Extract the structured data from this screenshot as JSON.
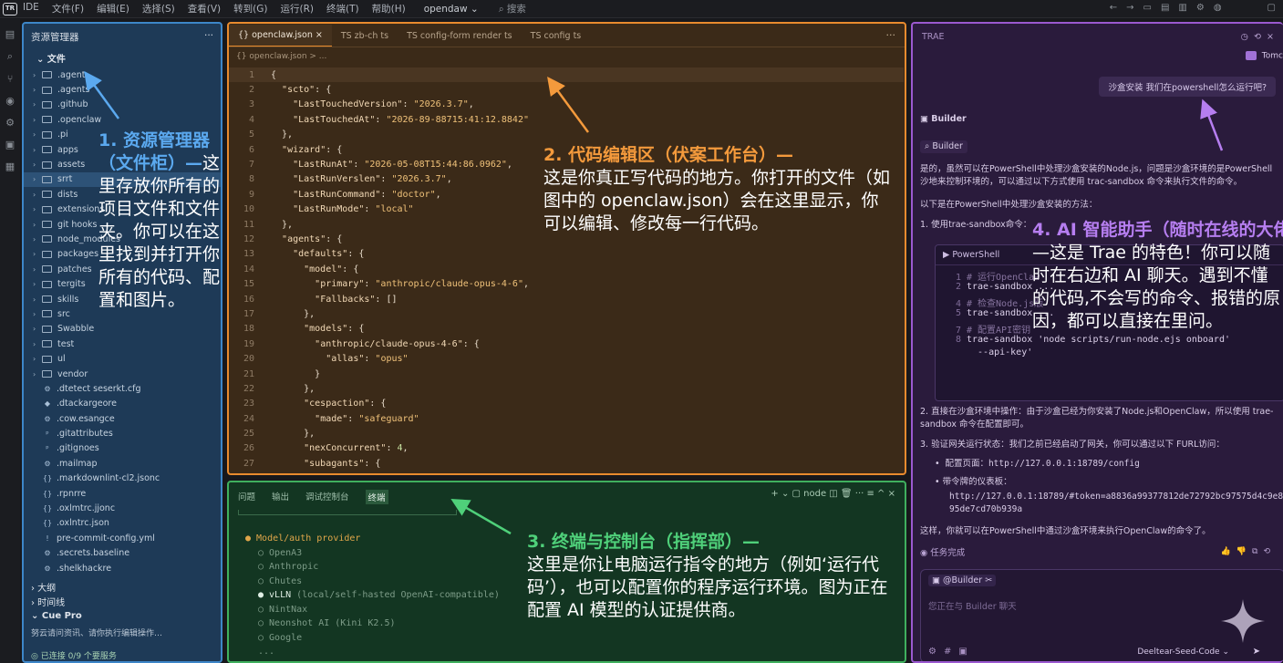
{
  "menubar": {
    "logo": "TR",
    "items": [
      "IDE",
      "文件(F)",
      "编辑(E)",
      "选择(S)",
      "查看(V)",
      "转到(G)",
      "运行(R)",
      "终端(T)",
      "帮助(H)"
    ],
    "project": "opendaw ⌄",
    "search": "⌕ 搜索"
  },
  "explorer": {
    "title": "资源管理器",
    "menu": "···",
    "section": "⌄ 文件",
    "folders": [
      ".agent",
      ".agents",
      ".github",
      ".openclaw",
      ".pi",
      "apps",
      "assets",
      "srrt",
      "dists",
      "extensions",
      "git hooks",
      "node_modules",
      "packages",
      "patches",
      "tergits",
      "skills",
      "src",
      "Swabble",
      "test",
      "ul",
      "vendor"
    ],
    "files": [
      {
        "icon": "⚙",
        "name": ".dtetect seserkt.cfg"
      },
      {
        "icon": "◆",
        "name": ".dtackargeore"
      },
      {
        "icon": "⚙",
        "name": ".cow.esangce"
      },
      {
        "icon": "ᵖ",
        "name": ".gitattributes"
      },
      {
        "icon": "ᵖ",
        "name": ".gitignoes"
      },
      {
        "icon": "⚙",
        "name": ".mailmap"
      },
      {
        "icon": "{}",
        "name": ".markdownlint-cl2.jsonc"
      },
      {
        "icon": "{}",
        "name": ".rpnrre"
      },
      {
        "icon": "{}",
        "name": ".oxlmtrc.jjonc"
      },
      {
        "icon": "{}",
        "name": ".oxlntrc.json"
      },
      {
        "icon": "!",
        "name": "pre-commit-config.yml"
      },
      {
        "icon": "⚙",
        "name": ".secrets.baseline"
      },
      {
        "icon": "⚙",
        "name": ".shelkhackre"
      }
    ],
    "outline": "› 大纲",
    "timeline": "› 时间线",
    "cue_title": "⌄ Cue Pro",
    "cue_text": "努云请问资讯、请你执行编辑操作…",
    "status": "◎ 已连接 0/9 个要服务"
  },
  "editor": {
    "tabs": [
      {
        "label": "{} openclaw.json ×",
        "active": true
      },
      {
        "label": "TS zb-ch ts",
        "active": false
      },
      {
        "label": "TS config-form render ts",
        "active": false
      },
      {
        "label": "TS config ts",
        "active": false
      }
    ],
    "tab_menu": "···",
    "breadcrumb": "{} openclaw.json > ...",
    "lines": [
      "{",
      "  \"scto\": {",
      "    \"LastTouchedVersion\": \"2026.3.7\",",
      "    \"LastTouchedAt\": \"2026-89-88715:41:12.8842\"",
      "  },",
      "  \"wizard\": {",
      "    \"LastRunAt\": \"2026-05-08T15:44:86.0962\",",
      "    \"LastRunVerslen\": \"2026.3.7\",",
      "    \"LastRunCommand\": \"doctor\",",
      "    \"LastRunMode\": \"local\"",
      "  },",
      "  \"agents\": {",
      "    \"defaults\": {",
      "      \"model\": {",
      "        \"primary\": \"anthropic/claude-opus-4-6\",",
      "        \"Fallbacks\": []",
      "      },",
      "      \"models\": {",
      "        \"anthropic/claude-opus-4-6\": {",
      "          \"allas\": \"opus\"",
      "        }",
      "      },",
      "      \"cespaction\": {",
      "        \"made\": \"safeguard\"",
      "      },",
      "      \"nexConcurrent\": 4,",
      "      \"subagants\": {"
    ]
  },
  "annotations": {
    "a1_h": "1. 资源管理器（文件柜）—",
    "a1_b": "这里存放你所有的项目文件和文件夹。你可以在这里找到并打开你所有的代码、配置和图片。",
    "a2_h": "2. 代码编辑区（伏案工作台）—",
    "a2_b": "这是你真正写代码的地方。你打开的文件（如图中的 openclaw.json）会在这里显示，你可以编辑、修改每一行代码。",
    "a3_h": "3. 终端与控制台（指挥部）—",
    "a3_b": "这里是你让电脑运行指令的地方（例如‘运行代码’），也可以配置你的程序运行环境。图为正在配置 AI 模型的认证提供商。",
    "a4_h": "4. AI 智能助手（随时在线的大佬",
    "a4_b": "—这是 Trae 的特色！你可以随时在右边和 AI 聊天。遇到不懂的代码,不会写的命令、报错的原因，都可以直接在里问。"
  },
  "terminal": {
    "tabs": [
      "问题",
      "输出",
      "调试控制台",
      "终端"
    ],
    "active_tab": "终端",
    "tools": "+ ⌄   ▢ node   ◫   🗑   ···   ≡  ^  ×",
    "header": "● Model/auth provider",
    "options": [
      "○ OpenA3",
      "○ Anthropic",
      "○ Chutes"
    ],
    "selected": "● vLLN",
    "selected_note": " (local/self-hasted OpenAI-compatible)",
    "options2": [
      "○ NintNax",
      "○ Neonshot AI (Kini K2.5)",
      "○ Google",
      "..."
    ]
  },
  "ai": {
    "title": "TRAE",
    "user_name": "Tomc",
    "user_msg": "沙盒安装 我们在powershell怎么运行吧?",
    "builder_label": "▣ Builder",
    "builder_tag": "⌕ Builder",
    "p1": "是的，虽然可以在PowerShell中处理沙盒安装的Node.js，问题是沙盒环境的是PowerShell沙地来控制环境的，可以通过以下方式使用 trac-sandbox 命令来执行文件的命令。",
    "p2": "以下是在PowerShell中处理沙盒安装的方法：",
    "p3": "1. 使用trae-sandbox命令：",
    "code_title": "▶ PowerShell",
    "code": [
      {
        "n": "1",
        "t": "# 运行OpenClaw",
        "c": true
      },
      {
        "n": "2",
        "t": "trae-sandbox ...",
        "c": false
      },
      {
        "n": "4",
        "t": "# 检查Node.js版",
        "c": true
      },
      {
        "n": "5",
        "t": "trae-sandbox ...",
        "c": false
      },
      {
        "n": "7",
        "t": "# 配置API密钥",
        "c": true
      },
      {
        "n": "8",
        "t": "trae-sandbox 'node scripts/run-node.ejs onboard'",
        "c": false
      },
      {
        "n": "",
        "t": "  --api-key'",
        "c": false
      }
    ],
    "p4": "2. 直接在沙盒环境中操作：由于沙盒已经为你安装了Node.js和OpenClaw，所以使用 trae-sandbox 命令在配置即可。",
    "p5": "3. 验证网关运行状态：我们之前已经启动了网关，你可以通过以下 FURL访问：",
    "b1": "• 配置页面：http://127.0.0.1:18789/config",
    "b2": "• 带令牌的仪表板：",
    "b3": "http://127.0.0.1:18789/#token=a8836a99377812de72792bc97575d4c9e895de7cd70b939a",
    "p6": "这样，你就可以在PowerShell中通过沙盒环境来执行OpenClaw的命令了。",
    "done": "◉ 任务完成",
    "input_tag": "▣ @Builder ✂",
    "input_placeholder": "您正在与 Builder 聊天",
    "model": "Deeltear-Seed-Code ⌄"
  }
}
